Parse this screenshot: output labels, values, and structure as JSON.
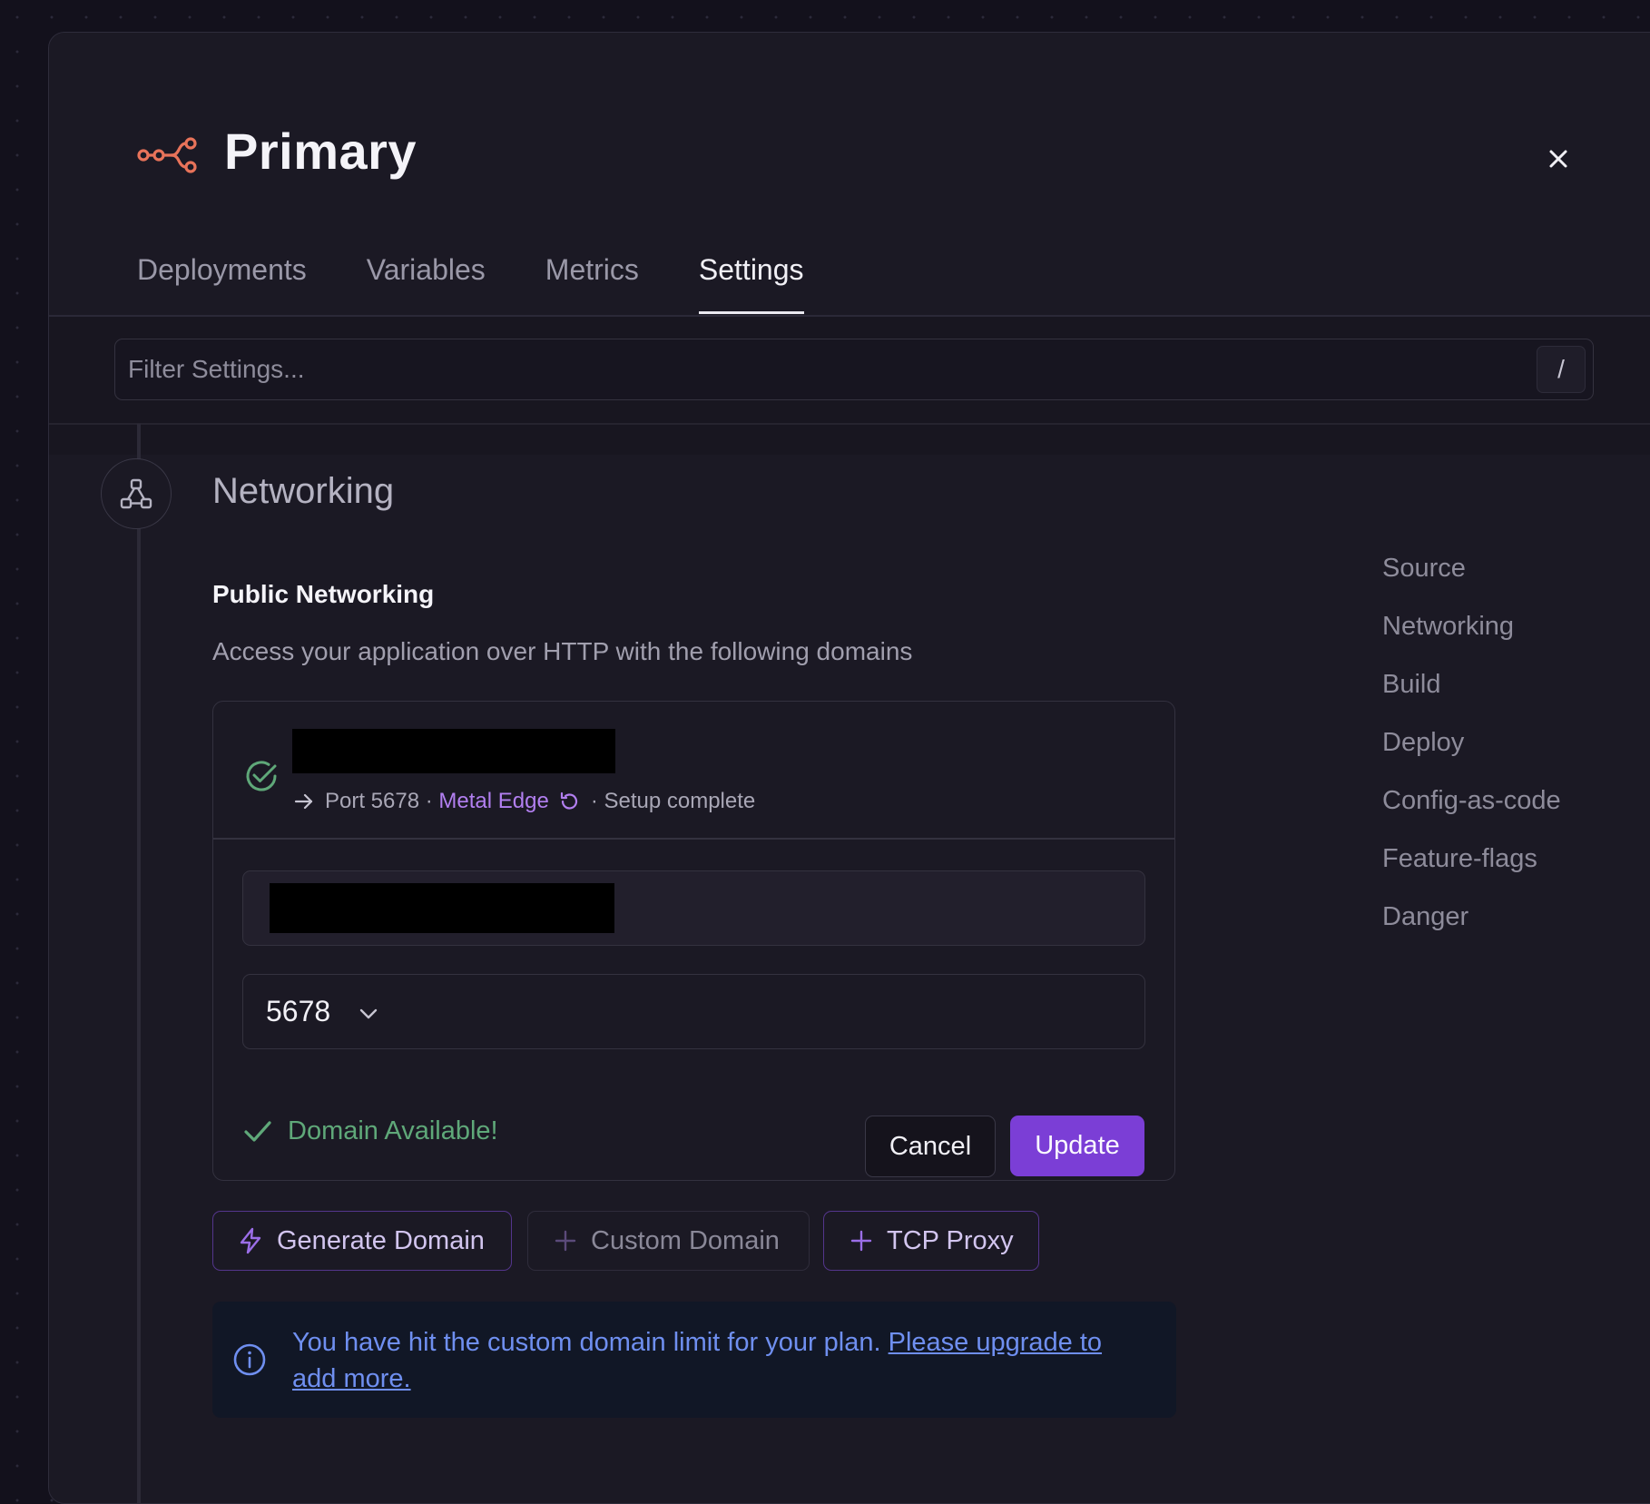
{
  "header": {
    "title": "Primary",
    "close_glyph": "×"
  },
  "tabs": [
    {
      "label": "Deployments",
      "active": false
    },
    {
      "label": "Variables",
      "active": false
    },
    {
      "label": "Metrics",
      "active": false
    },
    {
      "label": "Settings",
      "active": true
    }
  ],
  "filter": {
    "placeholder": "Filter Settings...",
    "shortcut": "/"
  },
  "section": {
    "title": "Networking",
    "public_title": "Public Networking",
    "description": "Access your application over HTTP with the following domains"
  },
  "domain": {
    "port_text": "Port 5678",
    "separator1": " · ",
    "edge_label": "Metal Edge",
    "status": "· Setup complete",
    "port_value": "5678",
    "availability": "Domain Available!"
  },
  "buttons": {
    "cancel": "Cancel",
    "update": "Update",
    "generate_domain": "Generate Domain",
    "custom_domain": "Custom Domain",
    "tcp_proxy": "TCP Proxy"
  },
  "info": {
    "message": "You have hit the custom domain limit for your plan. ",
    "link": "Please upgrade to add more."
  },
  "side_nav": [
    "Source",
    "Networking",
    "Build",
    "Deploy",
    "Config-as-code",
    "Feature-flags",
    "Danger"
  ],
  "colors": {
    "accent": "#7b3ed6",
    "logo": "#e8735a",
    "success": "#5fa879",
    "link_purple": "#b27ff0",
    "info_blue": "#6f8ff0"
  }
}
